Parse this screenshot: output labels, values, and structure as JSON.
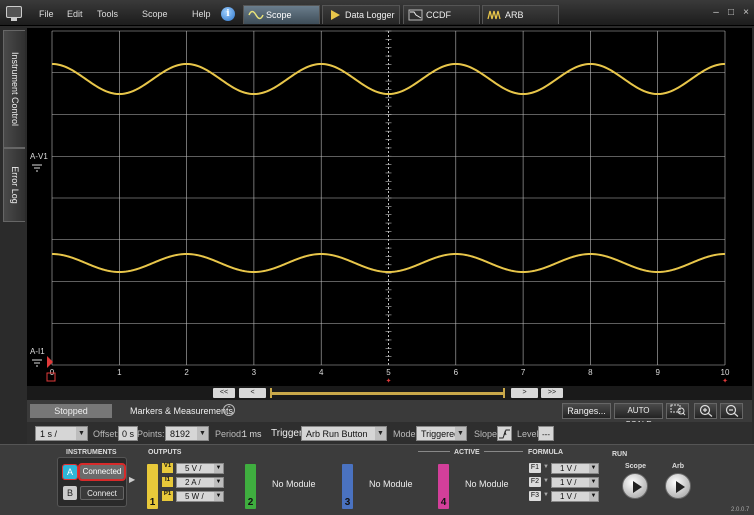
{
  "menu": {
    "file": "File",
    "edit": "Edit",
    "tools": "Tools",
    "scope": "Scope",
    "help": "Help",
    "info": "i"
  },
  "tabs": [
    {
      "label": "Scope",
      "icon": "sine-wave-icon",
      "active": true
    },
    {
      "label": "Data Logger",
      "icon": "play-arrow-icon",
      "active": false
    },
    {
      "label": "CCDF",
      "icon": "ccdf-chart-icon",
      "active": false
    },
    {
      "label": "ARB",
      "icon": "arb-wave-icon",
      "active": false
    }
  ],
  "side_tabs": {
    "instrument_control": "Instrument Control",
    "error_log": "Error Log"
  },
  "plot": {
    "channel_v1_label": "A-V1",
    "channel_i1_label": "A-I1",
    "x_ticks": [
      "0",
      "1",
      "2",
      "3",
      "4",
      "5",
      "6",
      "7",
      "8",
      "9",
      "10"
    ],
    "trace_color": "#e8c64a",
    "grid_color": "#bdbdbd",
    "divisions_x": 10,
    "divisions_y": 8
  },
  "chart_data": {
    "type": "line",
    "x": [
      0,
      10
    ],
    "xlim": [
      0,
      10
    ],
    "grid": true,
    "series": [
      {
        "name": "A-V1",
        "waveform": "sine",
        "cycles": 5,
        "color": "#e8c64a"
      },
      {
        "name": "A-I1",
        "waveform": "sine",
        "cycles": 5,
        "color": "#e8c64a"
      }
    ]
  },
  "scroll": {
    "first": "<<",
    "prev": "<",
    "next": ">",
    "last": ">>"
  },
  "status_bar": {
    "state": "Stopped",
    "markers_label": "Markers & Measurements",
    "markers_toggle": "⌃",
    "ranges_button": "Ranges...",
    "auto_scale_button": "AUTO SCALE"
  },
  "settings": {
    "timebase": "1 s /",
    "offset_label": "Offset:",
    "offset_value": "0 s",
    "points_label": "Points:",
    "points_value": "8192",
    "period_label": "Period:",
    "period_value": "1 ms",
    "trigger_label": "Trigger",
    "trigger_value": "Arb Run Button",
    "mode_label": "Mode:",
    "mode_value": "Triggered",
    "slope_label": "Slope:",
    "level_label": "Level:",
    "level_value": "---"
  },
  "bottom": {
    "instruments_title": "INSTRUMENTS",
    "instrument_a": {
      "letter": "A",
      "status": "Connected"
    },
    "instrument_b": {
      "letter": "B",
      "status": "Connect"
    },
    "outputs_title": "OUTPUTS",
    "active_title": "ACTIVE",
    "formula_title": "FORMULA",
    "run_title": "RUN",
    "slot1": {
      "number": "1",
      "v_badge": "V1",
      "i_badge": "I1",
      "p_badge": "P1",
      "v_value": "5 V /",
      "i_value": "2 A /",
      "p_value": "5 W /"
    },
    "slot2": {
      "number": "2",
      "text": "No Module",
      "color": "#3fae3f"
    },
    "slot3": {
      "number": "3",
      "text": "No Module",
      "color": "#4a72c0"
    },
    "slot4": {
      "number": "4",
      "text": "No Module",
      "color": "#d33f9a"
    },
    "formulas": [
      {
        "badge": "F1",
        "value": "1 V /"
      },
      {
        "badge": "F2",
        "value": "1 V /"
      },
      {
        "badge": "F3",
        "value": "1 V /"
      }
    ],
    "run_scope_label": "Scope",
    "run_arb_label": "Arb",
    "version": "2.0.0.7"
  }
}
